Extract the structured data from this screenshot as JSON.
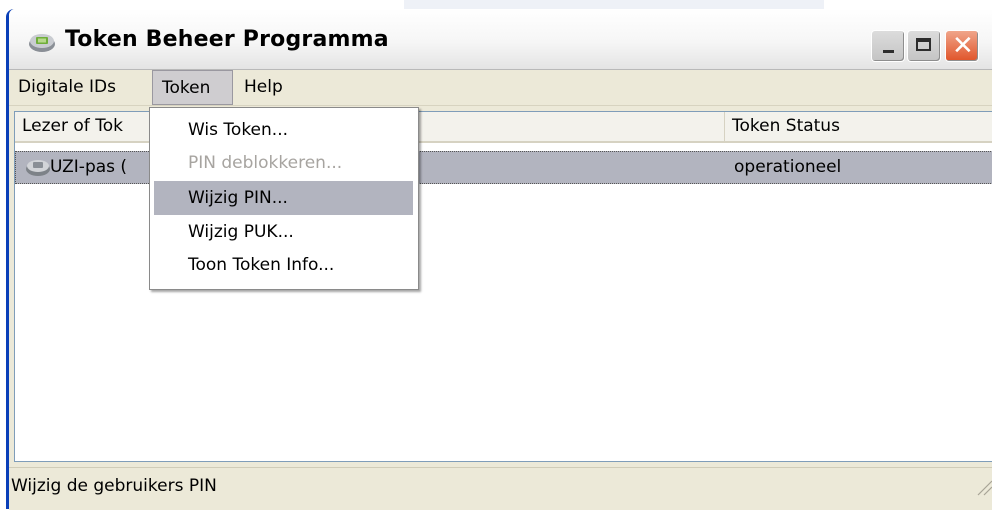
{
  "window": {
    "title": "Token Beheer Programma",
    "title_icon": "token-chip-icon"
  },
  "menubar": {
    "items": [
      {
        "label": "Digitale IDs"
      },
      {
        "label": "Token"
      },
      {
        "label": "Help"
      }
    ],
    "open_menu": "Token"
  },
  "token_menu": {
    "items": [
      {
        "label": "Wis Token...",
        "enabled": true
      },
      {
        "label": "PIN deblokkeren...",
        "enabled": false
      },
      {
        "label": "Wijzig PIN...",
        "enabled": true,
        "highlighted": true
      },
      {
        "label": "Wijzig PUK...",
        "enabled": true
      },
      {
        "label": "Toon Token Info...",
        "enabled": true
      }
    ]
  },
  "list": {
    "columns": [
      "Lezer of Tok",
      "Token Status"
    ],
    "rows": [
      {
        "name": "UZI-pas (",
        "status": "operationeel",
        "icon": "token-chip-icon",
        "selected": true
      }
    ]
  },
  "statusbar": {
    "text": "Wijzig de gebruikers PIN"
  },
  "colors": {
    "selection": "#b2b4bf",
    "window_face": "#ece9d8",
    "close_button": "#e0542a",
    "disabled_text": "#a7a4a0"
  }
}
